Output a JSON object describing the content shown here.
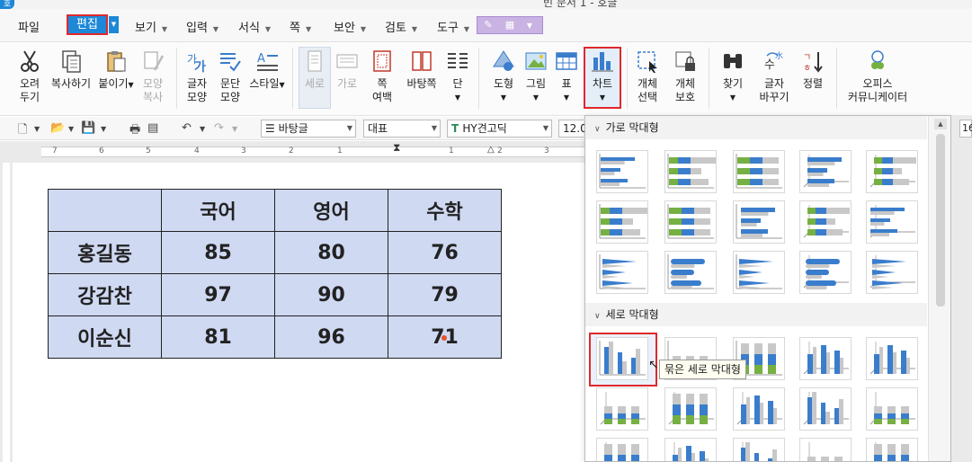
{
  "window": {
    "title": "빈 문서 1 - 호글",
    "logo": "호"
  },
  "menus": [
    {
      "label": "파일"
    },
    {
      "label": "편집"
    },
    {
      "label": "보기"
    },
    {
      "label": "입력"
    },
    {
      "label": "서식"
    },
    {
      "label": "쪽"
    },
    {
      "label": "보안"
    },
    {
      "label": "검토"
    },
    {
      "label": "도구"
    }
  ],
  "ribbon": {
    "cut": "오려\n두기",
    "copy": "복사하기",
    "paste": "붙이기",
    "format_copy": "모양\n복사",
    "char_shape": "글자\n모양",
    "para_shape": "문단\n모양",
    "style": "스타일",
    "portrait": "세로",
    "landscape": "가로",
    "page_margin": "쪽\n여백",
    "page_bg": "바탕쪽",
    "columns": "단",
    "shape": "도형",
    "picture": "그림",
    "table": "표",
    "chart": "차트",
    "obj_select": "개체\n선택",
    "obj_protect": "개체\n보호",
    "find": "찾기",
    "replace": "글자\n바꾸기",
    "sort": "정렬",
    "office_community": "오피스\n커뮤니케이터"
  },
  "toolbar": {
    "style_value": "바탕글",
    "lang_value": "대표",
    "font_value": "HY견고딕",
    "size_value": "12.0",
    "right_value": "16"
  },
  "ruler_numbers": [
    "7",
    "6",
    "5",
    "4",
    "3",
    "2",
    "1",
    "1",
    "2",
    "3"
  ],
  "table": {
    "header": [
      "",
      "국어",
      "영어",
      "수학"
    ],
    "rows": [
      [
        "홍길동",
        "85",
        "80",
        "76"
      ],
      [
        "강감찬",
        "97",
        "90",
        "79"
      ],
      [
        "이순신",
        "81",
        "96",
        "71"
      ]
    ]
  },
  "chart_panel": {
    "section_horizontal": "가로 막대형",
    "section_vertical": "세로 막대형",
    "tooltip": "묶은 세로 막대형"
  },
  "colors": {
    "accent": "#1d88d8",
    "highlight": "#e0282d",
    "table_bg": "#cfd9f2",
    "bar_blue": "#3a7dcc",
    "bar_green": "#76b043",
    "bar_gray": "#c8c8c8"
  }
}
